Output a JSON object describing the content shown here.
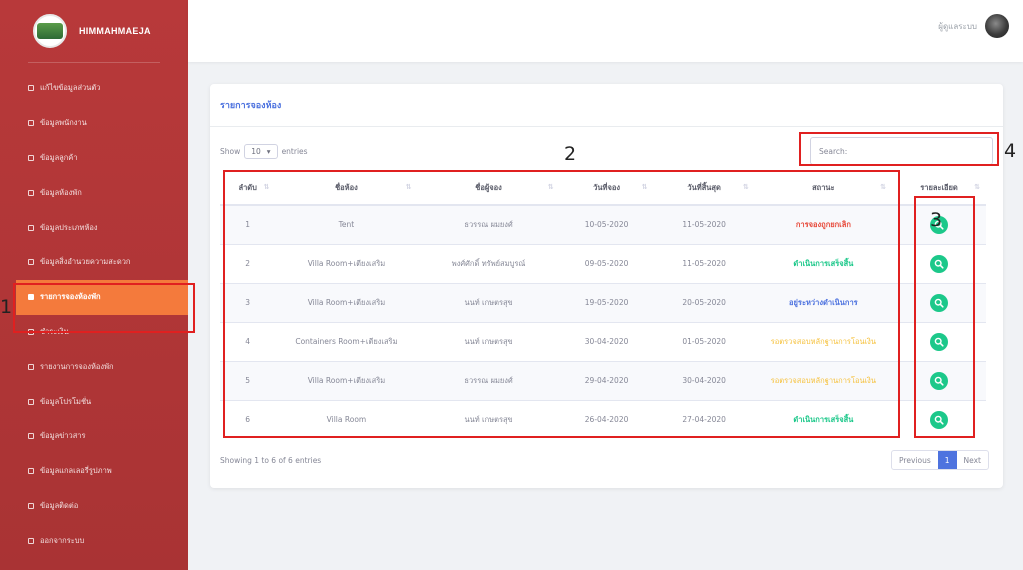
{
  "sidebar": {
    "brand": "HIMMAHMAEJA",
    "items": [
      {
        "label": "แก้ไขข้อมูลส่วนตัว"
      },
      {
        "label": "ข้อมูลพนักงาน"
      },
      {
        "label": "ข้อมูลลูกค้า"
      },
      {
        "label": "ข้อมูลห้องพัก"
      },
      {
        "label": "ข้อมูลประเภทห้อง"
      },
      {
        "label": "ข้อมูลสิ่งอำนวยความสะดวก"
      },
      {
        "label": "รายการจองห้องพัก",
        "active": true
      },
      {
        "label": "ชำระเงิน"
      },
      {
        "label": "รายงานการจองห้องพัก"
      },
      {
        "label": "ข้อมูลโปรโมชั่น"
      },
      {
        "label": "ข้อมูลข่าวสาร"
      },
      {
        "label": "ข้อมูลแกลเลอรี่รูปภาพ"
      },
      {
        "label": "ข้อมูลติดต่อ"
      },
      {
        "label": "ออกจากระบบ"
      }
    ]
  },
  "topbar": {
    "user_name": "ผู้ดูแลระบบ"
  },
  "card": {
    "title": "รายการจองห้อง",
    "length_show": "Show",
    "length_value": "10",
    "length_entries": "entries",
    "search_label": "Search:",
    "search_value": "",
    "headers": [
      "ลำดับ",
      "ชื่อห้อง",
      "ชื่อผู้จอง",
      "วันที่จอง",
      "วันที่สิ้นสุด",
      "สถานะ",
      "รายละเอียด"
    ],
    "rows": [
      {
        "no": "1",
        "room": "Tent",
        "customer": "ธวรรณ ผมยงศ์",
        "booked": "10-05-2020",
        "end": "11-05-2020",
        "status": "การจองถูกยกเลิก",
        "status_color": "red"
      },
      {
        "no": "2",
        "room": "Villa Room+เตียงเสริม",
        "customer": "พงศ์ศักดิ์ ทรัพย์สมบูรณ์",
        "booked": "09-05-2020",
        "end": "11-05-2020",
        "status": "ดำเนินการเสร็จสิ้น",
        "status_color": "green"
      },
      {
        "no": "3",
        "room": "Villa Room+เตียงเสริม",
        "customer": "นนท์ เกษตรสุข",
        "booked": "19-05-2020",
        "end": "20-05-2020",
        "status": "อยู่ระหว่างดำเนินการ",
        "status_color": "blue"
      },
      {
        "no": "4",
        "room": "Containers Room+เตียงเสริม",
        "customer": "นนท์ เกษตรสุข",
        "booked": "30-04-2020",
        "end": "01-05-2020",
        "status": "รอตรวจสอบหลักฐานการโอนเงิน",
        "status_color": "yellow"
      },
      {
        "no": "5",
        "room": "Villa Room+เตียงเสริม",
        "customer": "ธวรรณ ผมยงศ์",
        "booked": "29-04-2020",
        "end": "30-04-2020",
        "status": "รอตรวจสอบหลักฐานการโอนเงิน",
        "status_color": "yellow"
      },
      {
        "no": "6",
        "room": "Villa Room",
        "customer": "นนท์ เกษตรสุข",
        "booked": "26-04-2020",
        "end": "27-04-2020",
        "status": "ดำเนินการเสร็จสิ้น",
        "status_color": "green"
      }
    ],
    "info": "Showing 1 to 6 of 6 entries",
    "pager": {
      "prev": "Previous",
      "current": "1",
      "next": "Next"
    }
  },
  "annotations": [
    "1",
    "2",
    "3",
    "4"
  ],
  "colors": {
    "sidebar": "#b8393a",
    "active": "#f47a3c",
    "primary": "#4e73df",
    "success": "#1cc88a",
    "danger": "#e74a3b",
    "warning": "#f6c23e",
    "annotation": "#e02020"
  }
}
